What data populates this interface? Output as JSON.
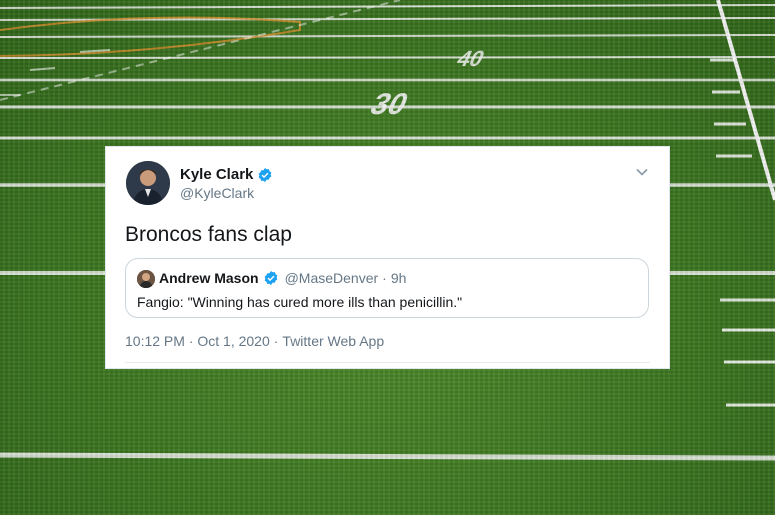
{
  "background": {
    "field_numbers": [
      "30",
      "40"
    ]
  },
  "tweet": {
    "author_name": "Kyle Clark",
    "author_handle": "@KyleClark",
    "text": "Broncos fans clap",
    "timestamp": "10:12 PM · Oct 1, 2020",
    "separator": "·",
    "source": "Twitter Web App",
    "colors": {
      "verified": "#1da1f2",
      "secondary_text": "#657786",
      "primary_text": "#14171a"
    }
  },
  "quoted_tweet": {
    "author_name": "Andrew Mason",
    "author_handle": "@MaseDenver",
    "separator": "·",
    "age": "9h",
    "text": "Fangio: \"Winning has cured more ills than penicillin.\""
  }
}
